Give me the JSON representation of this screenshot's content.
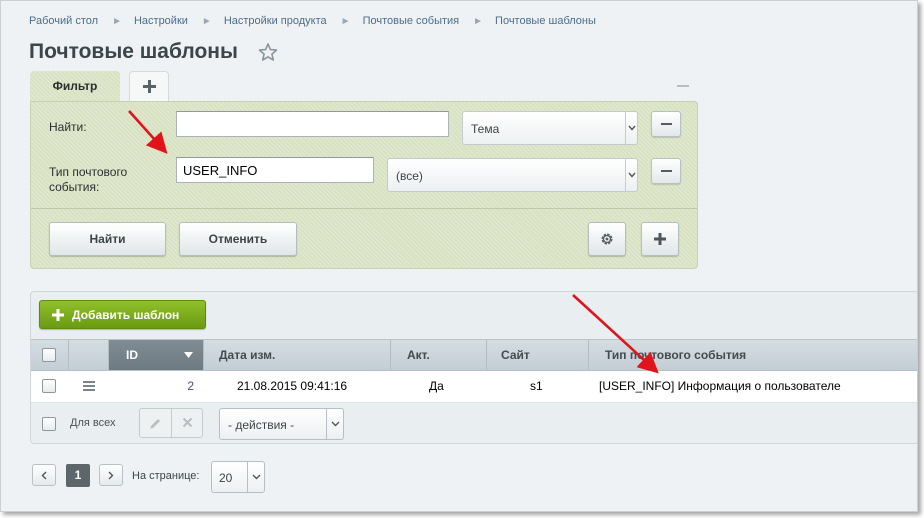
{
  "breadcrumb": [
    "Рабочий стол",
    "Настройки",
    "Настройки продукта",
    "Почтовые события",
    "Почтовые шаблоны"
  ],
  "page_title": "Почтовые шаблоны",
  "filter": {
    "tab_label": "Фильтр",
    "find_label": "Найти:",
    "find_value": "",
    "find_field_select": "Тема",
    "event_type_label": "Тип почтового события:",
    "event_type_value": "USER_INFO",
    "event_type_select": "(все)",
    "find_button": "Найти",
    "cancel_button": "Отменить"
  },
  "list": {
    "add_button": "Добавить шаблон",
    "columns": [
      "ID",
      "Дата изм.",
      "Акт.",
      "Сайт",
      "Тип почтового события"
    ],
    "rows": [
      {
        "id": "2",
        "date": "21.08.2015 09:41:16",
        "active": "Да",
        "site": "s1",
        "event_type": "[USER_INFO] Информация о пользователе"
      }
    ],
    "for_all_label": "Для всех",
    "actions_select": "- действия -"
  },
  "pagination": {
    "current_page": "1",
    "per_page_label": "На странице:",
    "per_page_value": "20"
  },
  "colors": {
    "filter_bg": "#d8e2c3",
    "add_button_green": "#7cae1e",
    "annotation_arrow": "#e0141a"
  }
}
